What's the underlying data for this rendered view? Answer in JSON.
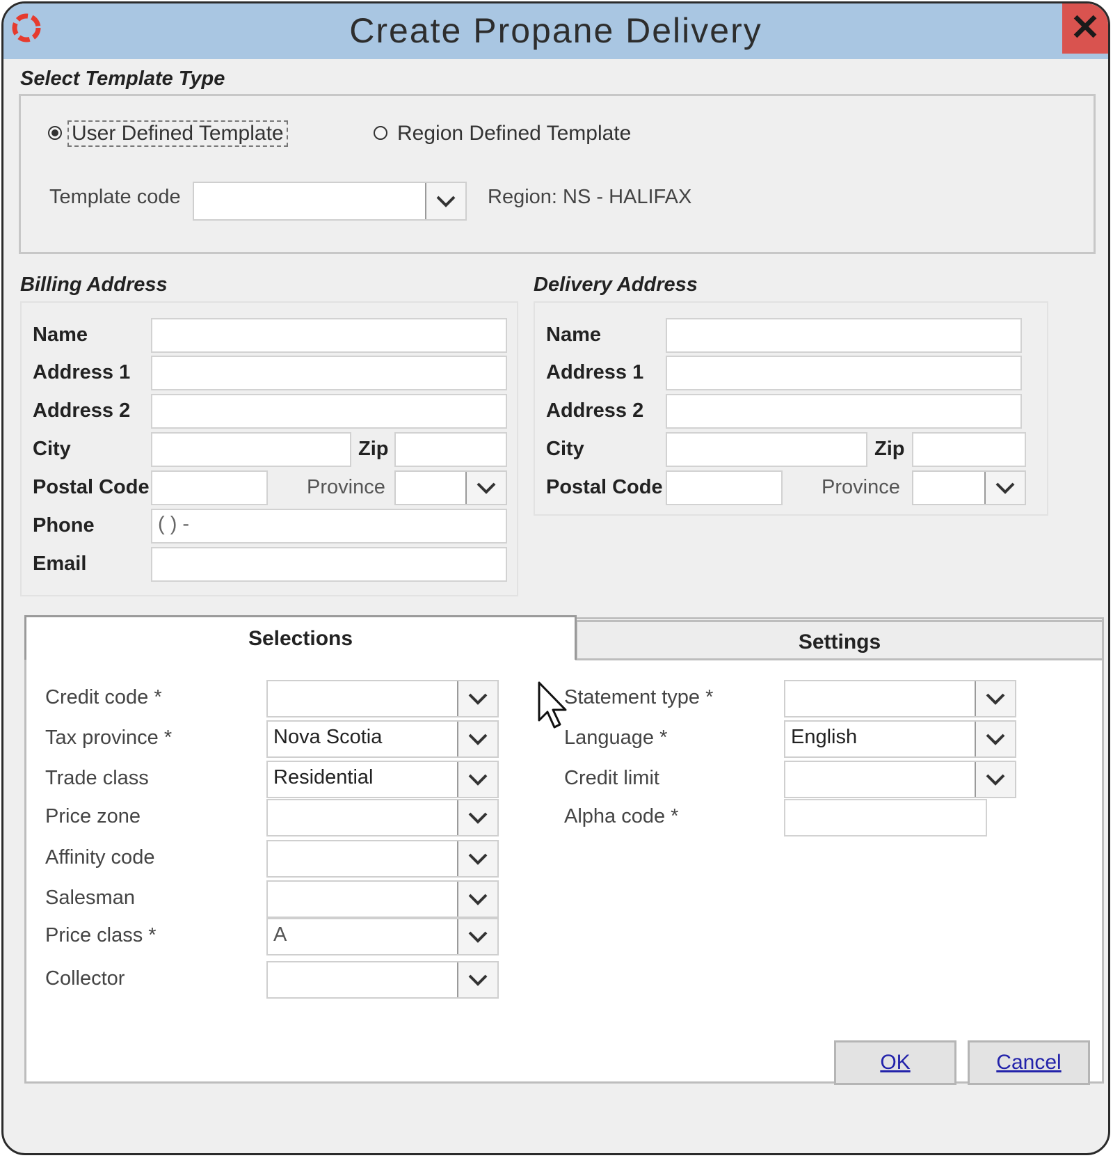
{
  "window": {
    "title": "Create Propane Delivery",
    "close_label": "✕",
    "accent_color": "#a9c6e2"
  },
  "template_type": {
    "section_title": "Select Template Type",
    "options": [
      {
        "label": "User Defined Template",
        "selected": true
      },
      {
        "label": "Region Defined Template",
        "selected": false
      }
    ],
    "template_code_label": "Template code",
    "template_code_value": "",
    "region_text": "Region: NS - HALIFAX"
  },
  "billing": {
    "section_title": "Billing Address",
    "name_label": "Name",
    "address1_label": "Address 1",
    "address2_label": "Address 2",
    "city_label": "City",
    "zip_label": "Zip",
    "postal_label": "Postal Code",
    "province_label": "Province",
    "phone_label": "Phone",
    "phone_value": "(  )  -",
    "email_label": "Email"
  },
  "delivery": {
    "section_title": "Delivery Address",
    "name_label": "Name",
    "address1_label": "Address 1",
    "address2_label": "Address 2",
    "city_label": "City",
    "zip_label": "Zip",
    "postal_label": "Postal Code",
    "province_label": "Province"
  },
  "tabs": {
    "selections": "Selections",
    "settings": "Settings"
  },
  "selections": {
    "credit_code_label": "Credit code *",
    "credit_code_value": "",
    "tax_province_label": "Tax province *",
    "tax_province_value": "Nova Scotia",
    "trade_class_label": "Trade class",
    "trade_class_value": "Residential",
    "price_zone_label": "Price zone",
    "price_zone_value": "",
    "affinity_code_label": "Affinity code",
    "affinity_code_value": "",
    "salesman_label": "Salesman",
    "salesman_value": "",
    "price_class_label": "Price class *",
    "price_class_value": "A",
    "collector_label": "Collector",
    "collector_value": ""
  },
  "settings": {
    "statement_type_label": "Statement type *",
    "statement_type_value": "",
    "language_label": "Language *",
    "language_value": "English",
    "credit_limit_label": "Credit limit",
    "credit_limit_value": "",
    "alpha_code_label": "Alpha code *",
    "alpha_code_value": ""
  },
  "footer": {
    "ok_label": "OK",
    "cancel_label": "Cancel"
  },
  "icons": [
    "app-logo-icon",
    "close-icon",
    "chevron-down-icon",
    "mouse-cursor-icon"
  ]
}
